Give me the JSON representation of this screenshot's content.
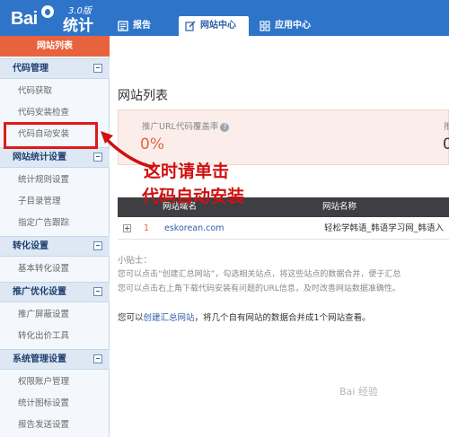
{
  "logo": {
    "brand": "Bai",
    "version": "3.0版",
    "product": "统计"
  },
  "tabs": [
    {
      "label": "报告"
    },
    {
      "label": "网站中心"
    },
    {
      "label": "应用中心"
    }
  ],
  "sidebar": {
    "active": "网站列表",
    "sections": [
      {
        "label": "代码管理",
        "items": [
          "代码获取",
          "代码安装检查",
          "代码自动安装"
        ]
      },
      {
        "label": "网站统计设置",
        "items": [
          "统计规则设置",
          "子目录管理",
          "指定广告跟踪"
        ]
      },
      {
        "label": "转化设置",
        "items": [
          "基本转化设置"
        ]
      },
      {
        "label": "推广优化设置",
        "items": [
          "推广屏蔽设置",
          "转化出价工具"
        ]
      },
      {
        "label": "系统管理设置",
        "items": [
          "权限账户管理",
          "统计图标设置",
          "报告发送设置"
        ]
      }
    ]
  },
  "main": {
    "title": "网站列表",
    "coverage_label": "推广URL代码覆盖率",
    "coverage_value": "0%",
    "second_label": "推",
    "second_value": "0",
    "table": {
      "headers": [
        "网站域名",
        "网站名称"
      ],
      "rows": [
        {
          "index": "1",
          "domain": "eskorean.com",
          "name": "轻松学韩语_韩语学习网_韩语入"
        }
      ]
    },
    "tips_title": "小贴士：",
    "tips_line1": "您可以点击“创建汇总网站”，勾选相关站点，将这些站点的数据合并，便于汇总",
    "tips_line2": "您可以点击右上角下载代码安装有问题的URL信息，及时改善网站数据准确性。",
    "merge_prefix": "您可以",
    "merge_link": "创建汇总网站",
    "merge_suffix": "，将几个自有网站的数据合并成1个网站查看。"
  },
  "annotation": {
    "line1": "这时请单击",
    "line2": "代码自动安装"
  },
  "watermark": "Bai 经验",
  "colors": {
    "topbar": "#2e74c8",
    "active": "#e9623e",
    "annotation": "#d01010"
  }
}
